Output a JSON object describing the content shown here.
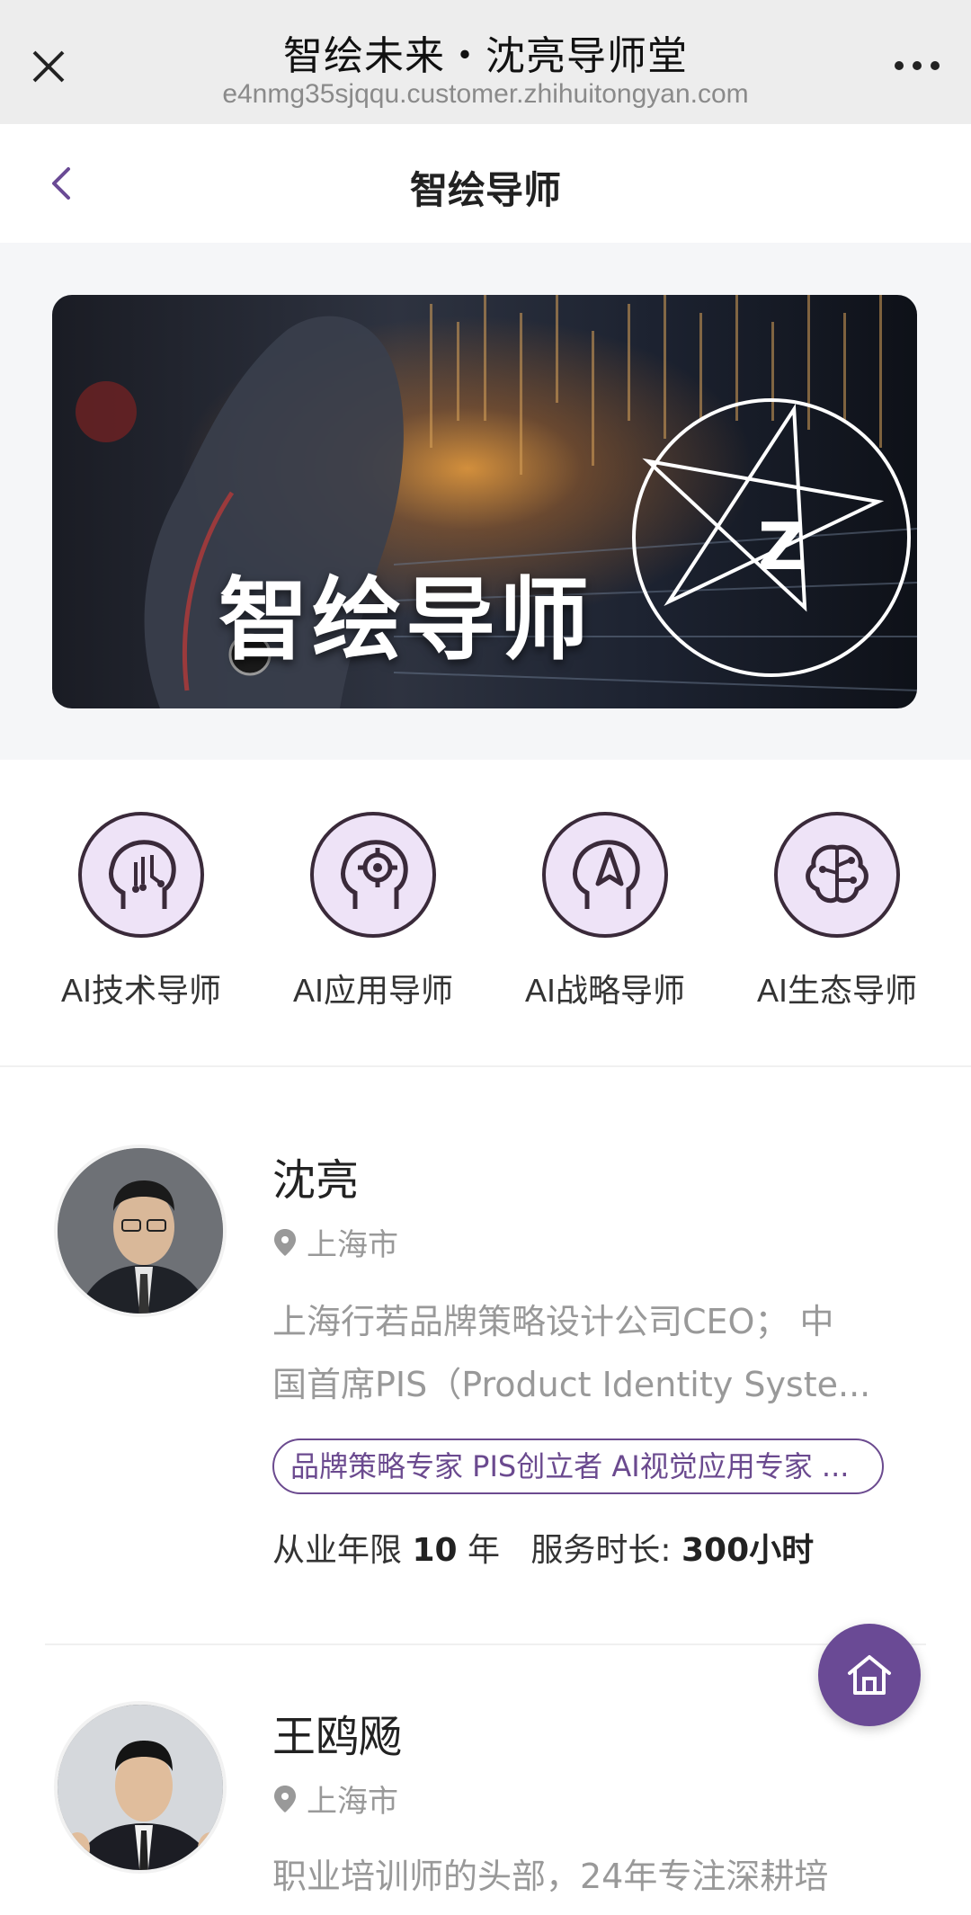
{
  "browser": {
    "title": "智绘未来・沈亮导师堂",
    "url": "e4nmg35sjqqu.customer.zhihuitongyan.com"
  },
  "header": {
    "title": "智绘导师"
  },
  "banner": {
    "title": "智绘导师",
    "logo_letter": "Z"
  },
  "categories": [
    {
      "label": "AI技术导师",
      "icon": "circuit-head-icon"
    },
    {
      "label": "AI应用导师",
      "icon": "gear-head-icon"
    },
    {
      "label": "AI战略导师",
      "icon": "compass-head-icon"
    },
    {
      "label": "AI生态导师",
      "icon": "brain-network-icon"
    }
  ],
  "mentors": [
    {
      "name": "沈亮",
      "location": "上海市",
      "desc_line1": "上海行若品牌策略设计公司CEO；  中",
      "desc_line2": "国首席PIS（Product Identity Syste...",
      "tags": "品牌策略专家 PIS创立者 AI视觉应用专家 ...",
      "years_label": "从业年限",
      "years_value": "10",
      "years_unit": "年",
      "hours_label": "服务时长:",
      "hours_value": "300小时"
    },
    {
      "name": "王鸥飏",
      "location": "上海市",
      "desc_line1": "职业培训师的头部，24年专注深耕培"
    }
  ],
  "colors": {
    "accent": "#6a4a95",
    "icon_bg": "#eee3f7"
  }
}
